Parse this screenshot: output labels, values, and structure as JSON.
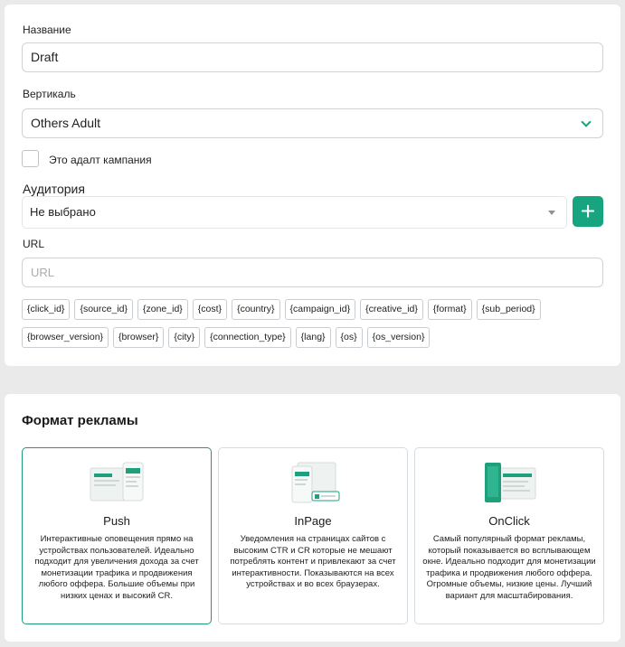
{
  "form": {
    "name_label": "Название",
    "name_value": "Draft",
    "vertical_label": "Вертикаль",
    "vertical_value": "Others Adult",
    "adult_checkbox_label": "Это адалт кампания",
    "audience_label": "Аудитория",
    "audience_value": "Не выбрано",
    "add_audience_symbol": "+",
    "url_label": "URL",
    "url_placeholder": "URL",
    "macros_row1": [
      "{click_id}",
      "{source_id}",
      "{zone_id}",
      "{cost}",
      "{country}",
      "{campaign_id}",
      "{creative_id}",
      "{format}",
      "{sub_period}"
    ],
    "macros_row2": [
      "{browser_version}",
      "{browser}",
      "{city}",
      "{connection_type}",
      "{lang}",
      "{os}",
      "{os_version}"
    ]
  },
  "format": {
    "title": "Формат рекламы",
    "options": [
      {
        "title": "Push",
        "desc": "Интерактивные оповещения прямо на устройствах пользователей. Идеально подходит для увеличения дохода за счет монетизации трафика и продвижения любого оффера. Большие объемы при низких ценах и высокий CR.",
        "icon": "push-illustration-icon"
      },
      {
        "title": "InPage",
        "desc": "Уведомления на страницах сайтов с высоким CTR и CR которые не мешают потреблять контент и привлекают за счет интерактивности. Показываются на всех устройствах и во всех браузерах.",
        "icon": "inpage-illustration-icon"
      },
      {
        "title": "OnClick",
        "desc": "Самый популярный формат рекламы, который показывается во всплывающем окне. Идеально подходит для монетизации трафика и продвижения любого оффера. Огромные объемы, низкие цены. Лучший вариант для масштабирования.",
        "icon": "onclick-illustration-icon"
      }
    ]
  },
  "colors": {
    "accent": "#16a57e",
    "selected_border": "#1b9c78",
    "page_background": "#eaeaea"
  }
}
